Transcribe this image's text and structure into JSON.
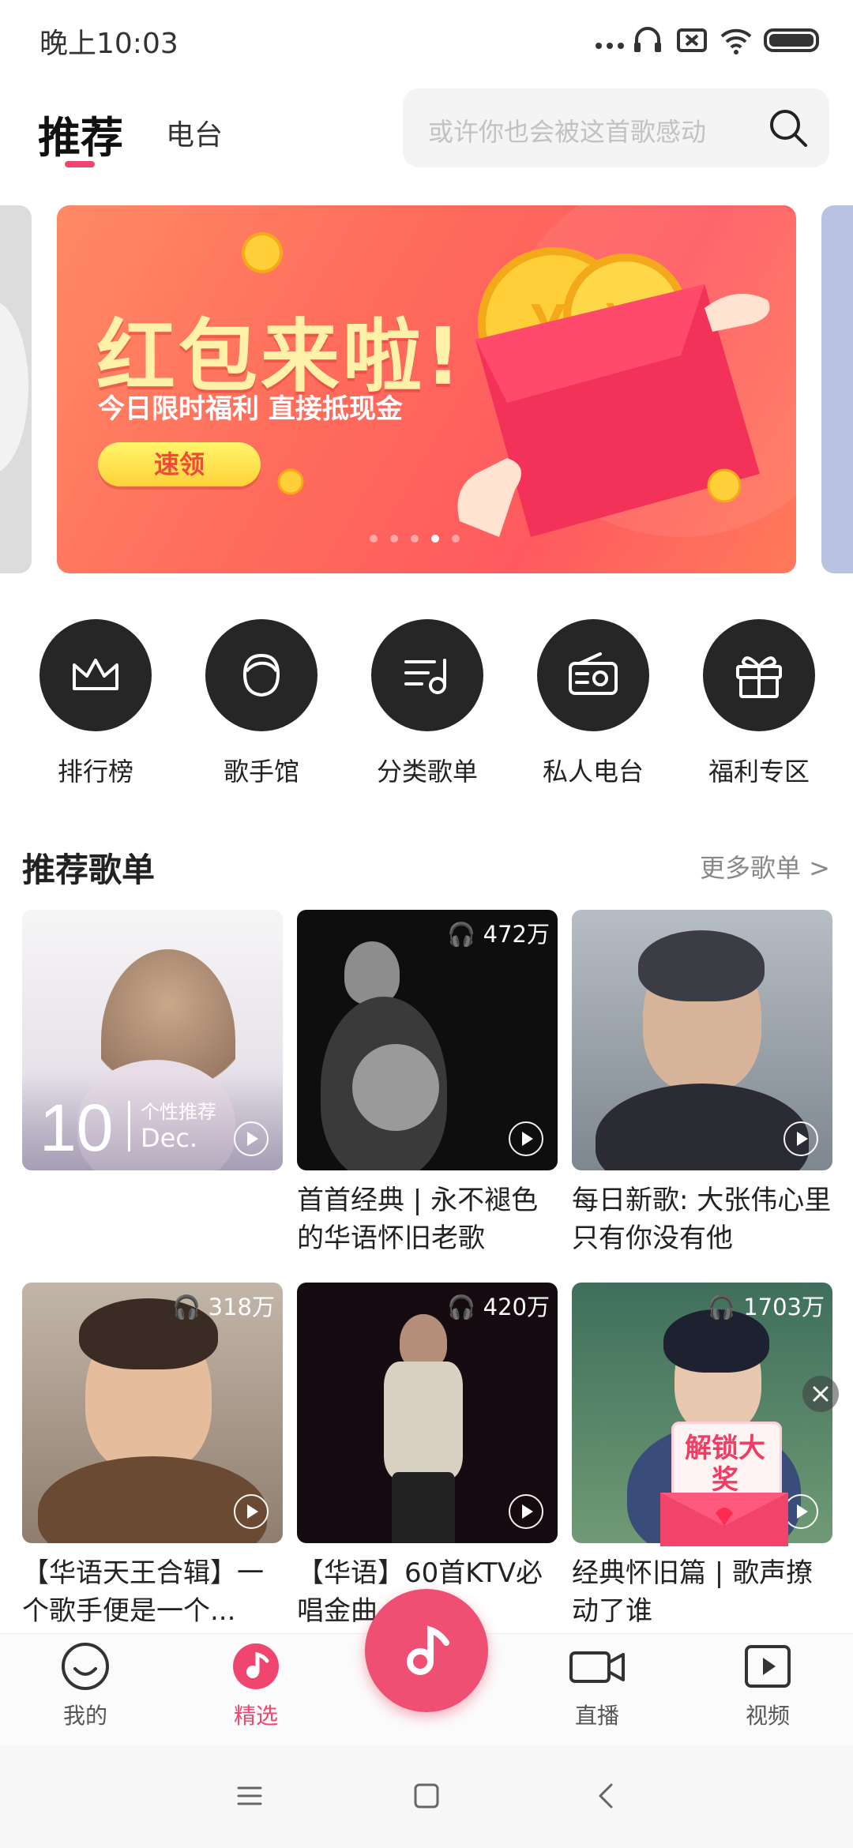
{
  "status_bar": {
    "time": "晚上10:03"
  },
  "header": {
    "tabs": [
      {
        "label": "推荐",
        "active": true
      },
      {
        "label": "电台",
        "active": false
      }
    ],
    "search": {
      "placeholder": "或许你也会被这首歌感动"
    }
  },
  "banner": {
    "title": "红包来啦!",
    "subtitle": "今日限时福利 直接抵现金",
    "button": "速领",
    "page_count": 5,
    "active_page": 4
  },
  "categories": [
    {
      "label": "排行榜",
      "icon": "crown-icon"
    },
    {
      "label": "歌手馆",
      "icon": "singer-face-icon"
    },
    {
      "label": "分类歌单",
      "icon": "playlist-note-icon"
    },
    {
      "label": "私人电台",
      "icon": "radio-icon"
    },
    {
      "label": "福利专区",
      "icon": "gift-icon"
    }
  ],
  "section": {
    "title": "推荐歌单",
    "more": "更多歌单 >"
  },
  "playlists": [
    {
      "title": "",
      "count": "",
      "day": "10",
      "month": "Dec.",
      "tag": "个性推荐"
    },
    {
      "title": "首首经典 | 永不褪色的华语怀旧老歌",
      "count": "472万"
    },
    {
      "title": "每日新歌: 大张伟心里只有你没有他",
      "count": ""
    },
    {
      "title": "【华语天王合辑】一个歌手便是一个...",
      "count": "318万"
    },
    {
      "title": "【华语】60首KTV必唱金曲",
      "count": "420万"
    },
    {
      "title": "经典怀旧篇 | 歌声撩动了谁",
      "count": "1703万"
    }
  ],
  "promo_badge": {
    "text": "解锁大奖"
  },
  "bottom_nav": [
    {
      "label": "我的",
      "icon": "smile-icon",
      "active": false
    },
    {
      "label": "精选",
      "icon": "music-disc-icon",
      "active": true
    },
    {
      "label": "直播",
      "icon": "video-camera-icon",
      "active": false
    },
    {
      "label": "视频",
      "icon": "video-play-icon",
      "active": false
    }
  ],
  "colors": {
    "accent": "#f0456f",
    "banner": "#ff6b5b",
    "icon_bg": "#262626"
  }
}
